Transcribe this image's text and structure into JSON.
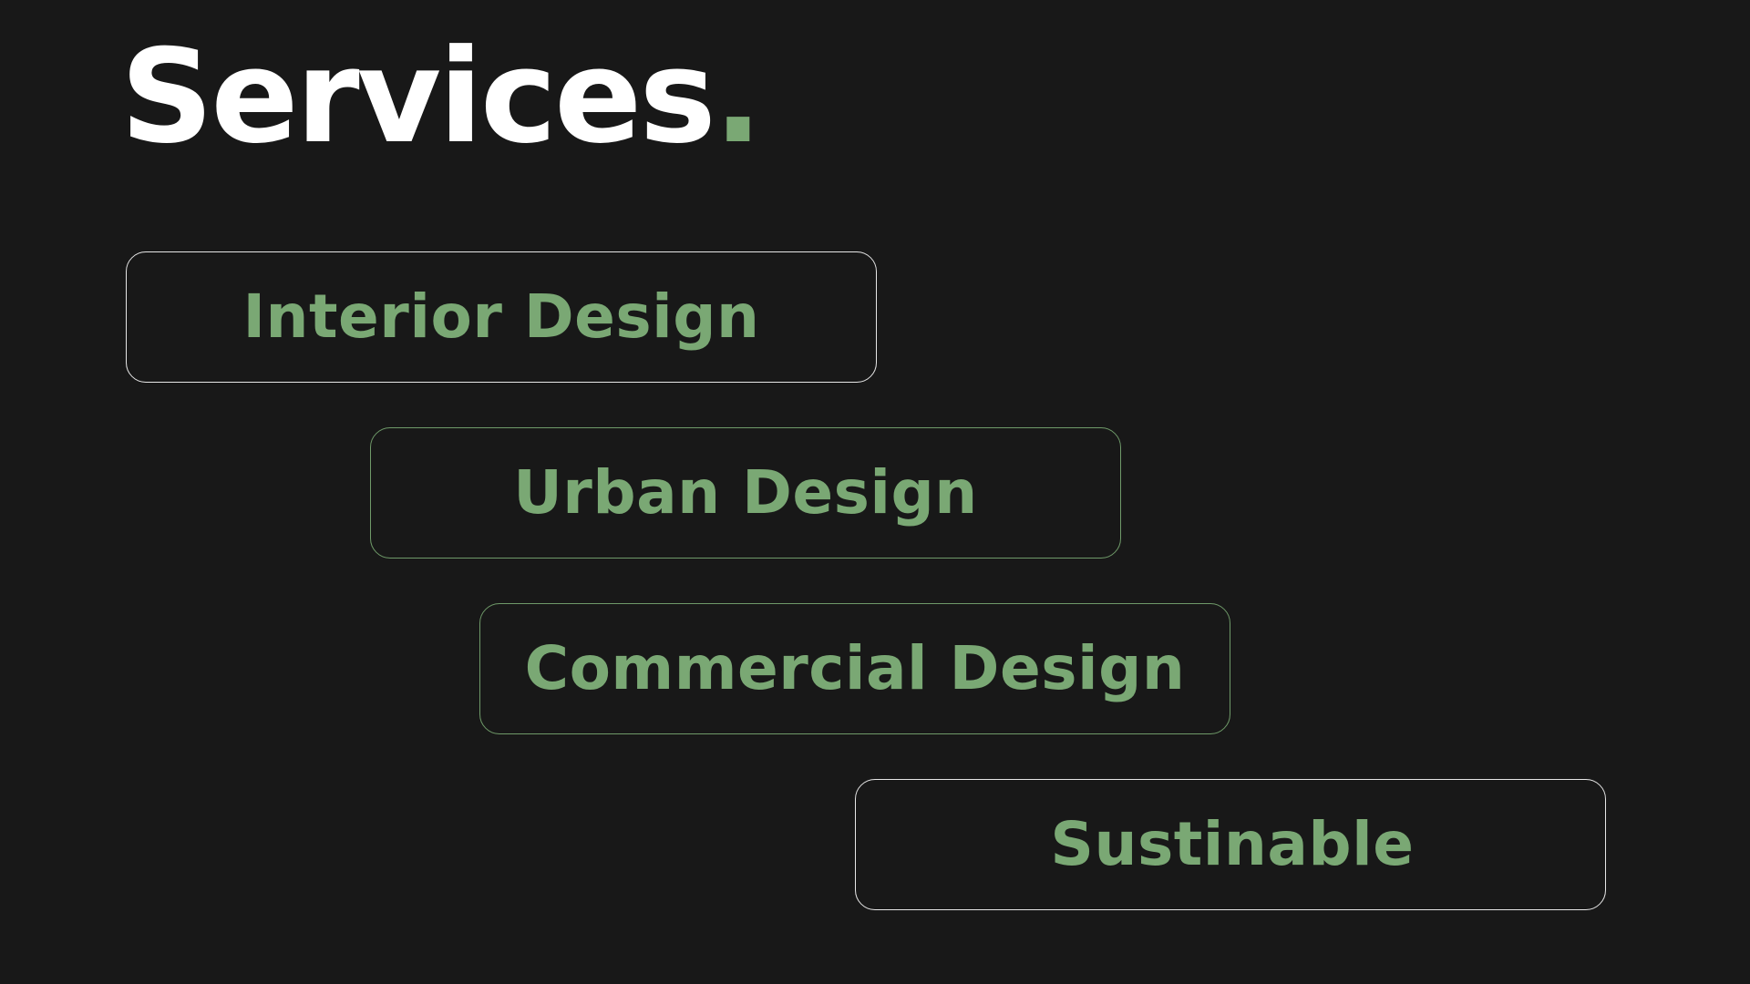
{
  "page": {
    "title": "Services",
    "title_dot": ".",
    "accent_color": "#7aa874",
    "background_color": "#181818"
  },
  "services": [
    {
      "label": "Interior Design",
      "border_style": "light"
    },
    {
      "label": "Urban Design",
      "border_style": "green"
    },
    {
      "label": "Commercial Design",
      "border_style": "green"
    },
    {
      "label": "Sustinable",
      "border_style": "light"
    }
  ]
}
